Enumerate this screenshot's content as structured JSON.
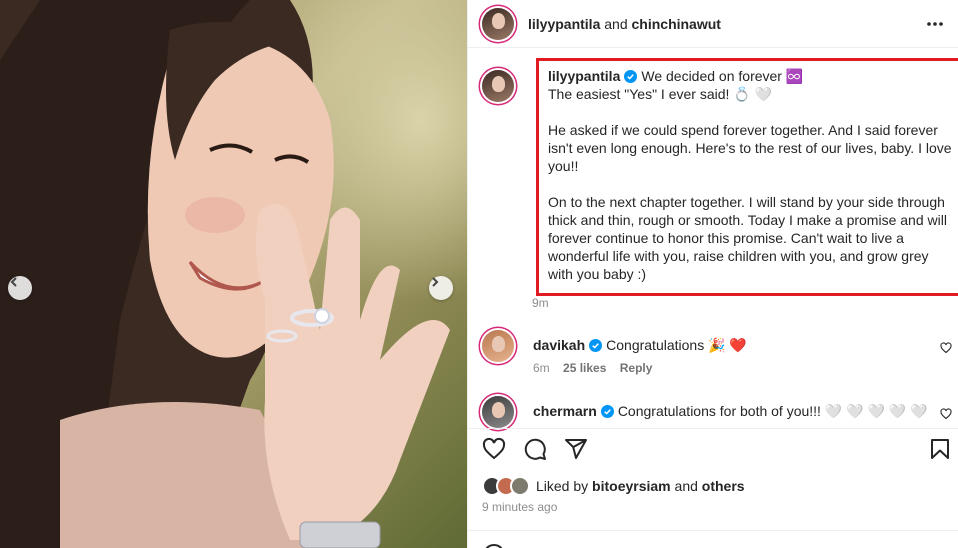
{
  "header": {
    "user": "lilyypantila",
    "connector": "and",
    "coauthor": "chinchinawut",
    "more_icon": "more-horizontal-icon"
  },
  "caption": {
    "username": "lilyypantila",
    "title": "We decided on forever ♾️",
    "line2": "The easiest \"Yes\" I ever said! 💍 🤍",
    "para1": "He asked if we could spend forever together. And I said forever isn't even long enough. Here's to the rest of our lives, baby. I love you!!",
    "para2": "On to the next chapter together. I will stand by your side through thick and thin, rough or smooth. Today I make a promise and will forever continue to honor this promise. Can't wait to live a wonderful life with you, raise children with you, and grow grey with you baby :)",
    "time": "9m",
    "highlight_color": "#e11b22"
  },
  "comments": [
    {
      "username": "davikah",
      "text": "Congratulations 🎉 ❤️",
      "time": "6m",
      "likes": "25 likes",
      "reply": "Reply"
    },
    {
      "username": "chermarn",
      "text": "Congratulations for both of you!!! 🤍 🤍 🤍 🤍 🤍"
    }
  ],
  "likes": {
    "prefix": "Liked by",
    "user": "bitoeyrsiam",
    "and": "and",
    "others": "others"
  },
  "posted_ago": "9 minutes ago",
  "icons": {
    "like": "heart-icon",
    "comment": "comment-icon",
    "share": "share-icon",
    "save": "bookmark-icon",
    "prev": "chevron-left-icon",
    "next": "chevron-right-icon",
    "verified": "verified-badge-icon"
  },
  "colors": {
    "accent_blue": "#0095f6",
    "text": "#262626",
    "muted": "#8e8e8e"
  }
}
